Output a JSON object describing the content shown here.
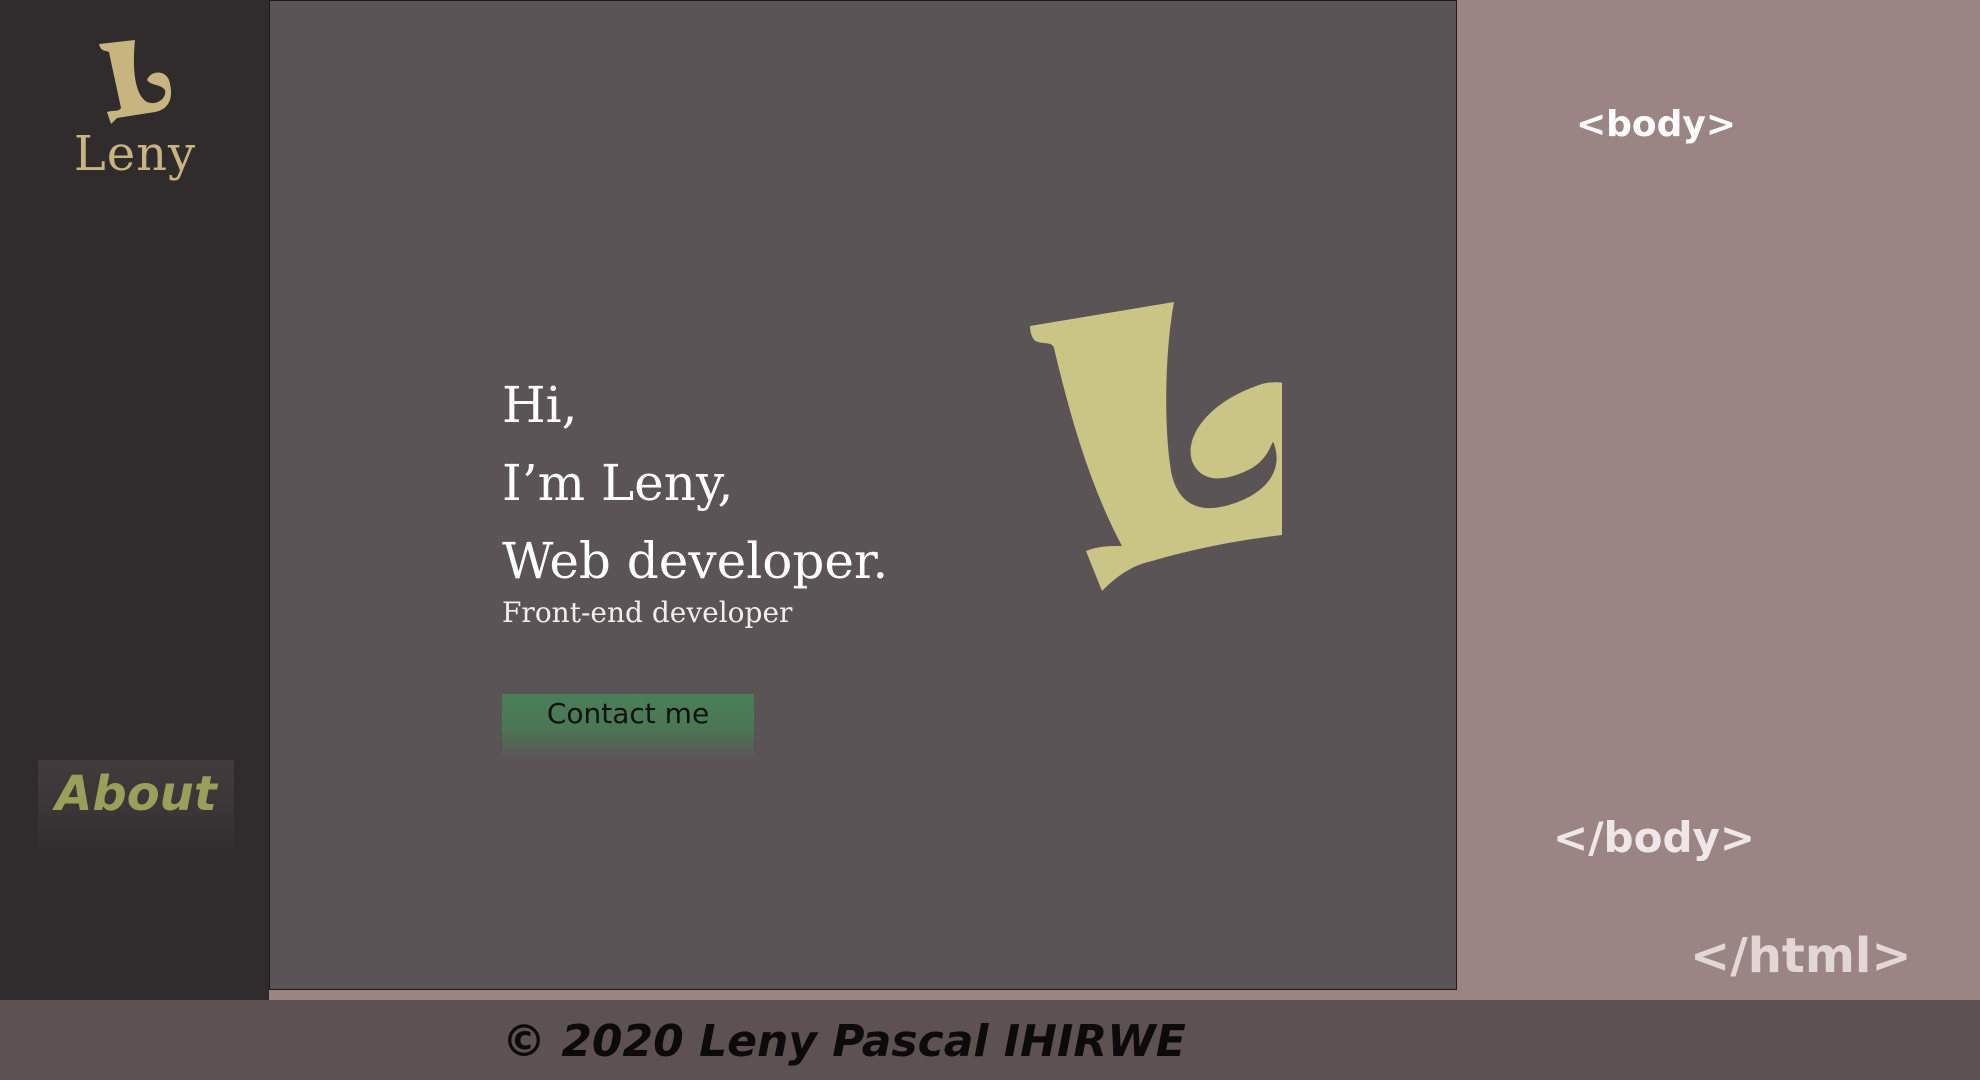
{
  "sidebar": {
    "logo": {
      "text": "Leny",
      "icon": "leny-logo-icon"
    },
    "about_label": "About"
  },
  "hero": {
    "line1": "Hi,",
    "line2": "I’m Leny,",
    "line3": "Web developer.",
    "subtitle": "Front-end developer",
    "contact_label": "Contact me"
  },
  "decorations": {
    "body_open": "<body>",
    "body_close": "</body>",
    "html_close": "</html>"
  },
  "footer": {
    "copyright": "© 2020 Leny Pascal IHIRWE"
  },
  "colors": {
    "sidebar_bg": "#302c2d",
    "main_bg": "#5b5456",
    "right_bg": "#9b8584",
    "footer_bg": "#5e5151",
    "logo_gold": "#c8b47f",
    "big_logo": "#cbc585",
    "about_text": "#9aa057",
    "contact_bg": "#4a7f58"
  }
}
